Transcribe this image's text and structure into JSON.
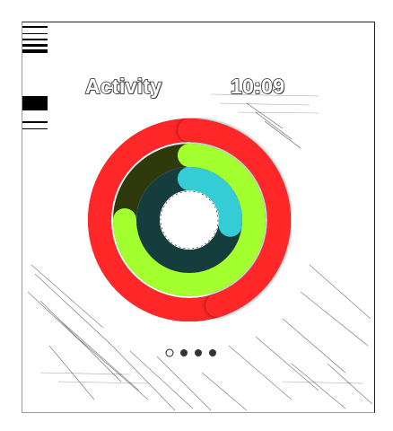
{
  "app": {
    "title": "Activity"
  },
  "status": {
    "time": "10:09"
  },
  "rings": [
    {
      "name": "move",
      "progress": 1.45,
      "color": "#ff2727",
      "track_color": "#3f0a1c"
    },
    {
      "name": "exercise",
      "progress": 0.75,
      "color": "#a3ff2e",
      "track_color": "#2f3a0c"
    },
    {
      "name": "stand",
      "progress": 0.27,
      "color": "#34cdd6",
      "track_color": "#163d3d"
    }
  ],
  "pager": {
    "page_count": 4,
    "current_page": 1
  }
}
